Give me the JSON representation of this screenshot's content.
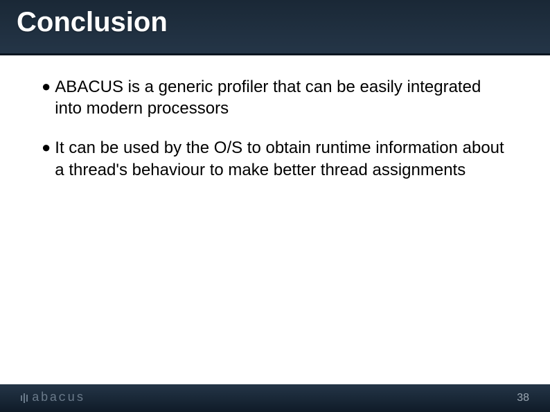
{
  "header": {
    "title": "Conclusion"
  },
  "content": {
    "bullets": [
      "ABACUS is a generic profiler that can be easily integrated into modern processors",
      "It can be used by the O/S to obtain runtime information about a thread's behaviour to make better thread assignments"
    ]
  },
  "footer": {
    "logo_text": "abacus",
    "page_number": "38"
  }
}
